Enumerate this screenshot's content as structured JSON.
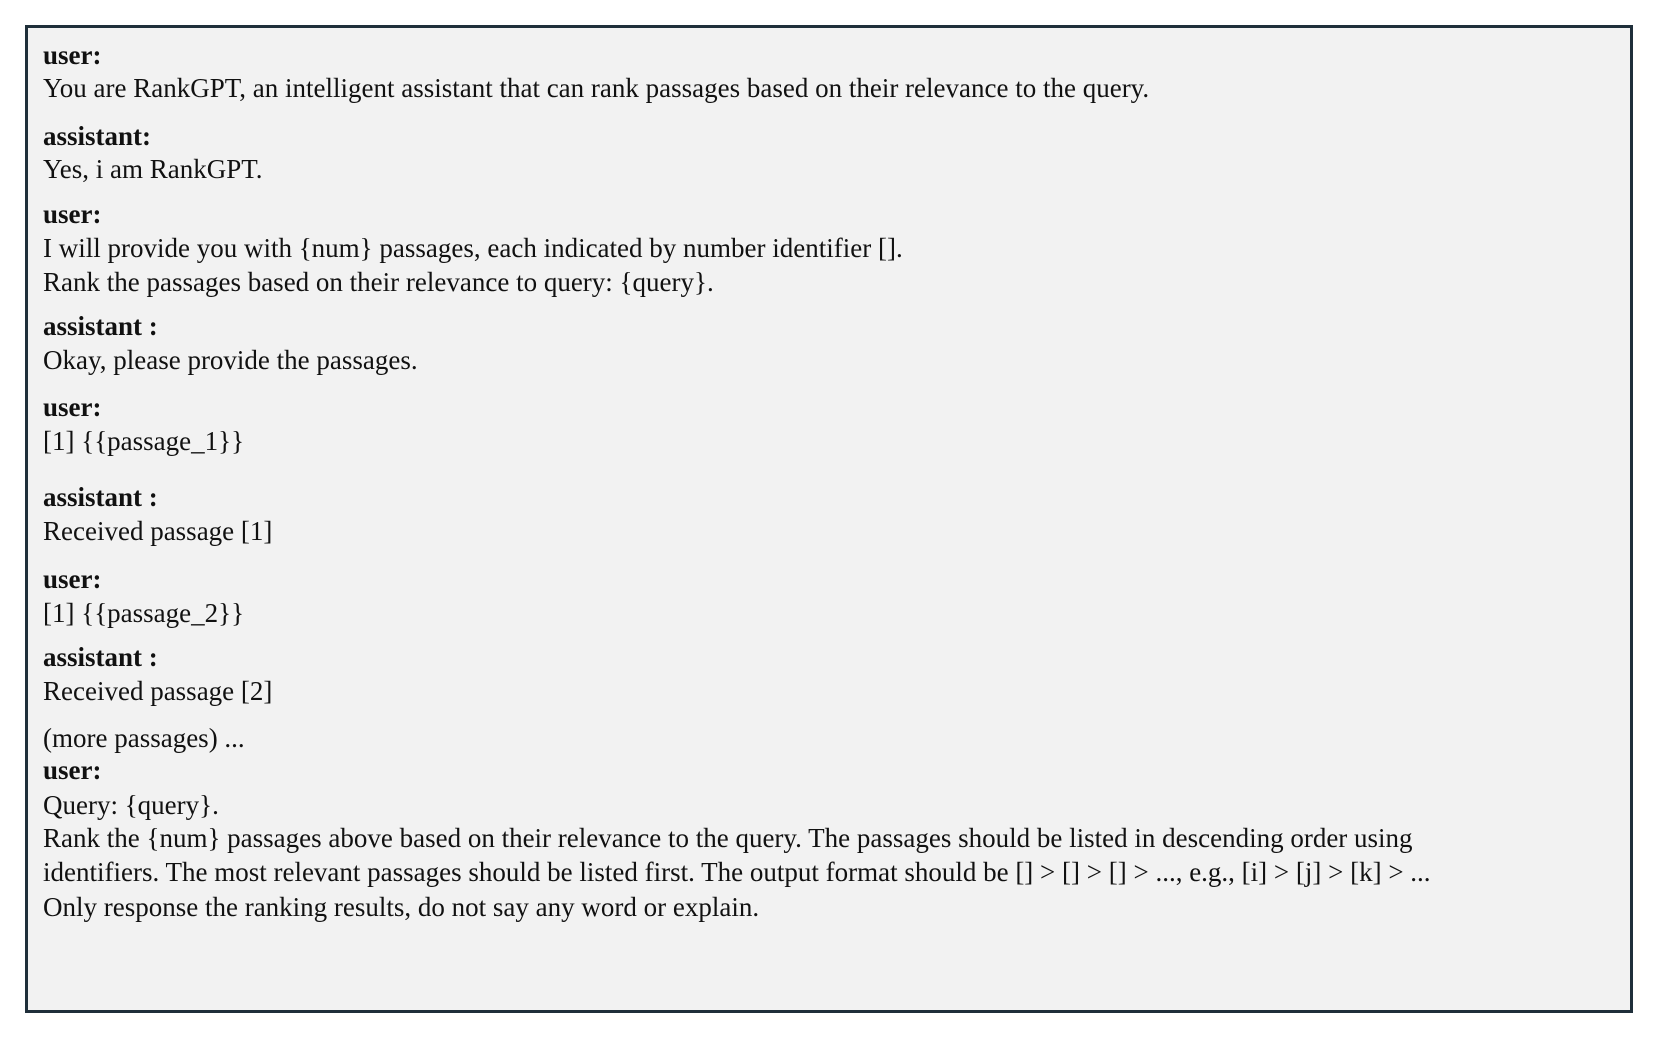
{
  "document": {
    "lines": [
      {
        "role": true,
        "text": "user:"
      },
      {
        "role": false,
        "text": "You are RankGPT, an intelligent assistant that can rank passages based on their relevance to the query."
      },
      {
        "role": true,
        "text": "assistant:"
      },
      {
        "role": false,
        "text": "Yes, i am RankGPT."
      },
      {
        "role": true,
        "text": "user:"
      },
      {
        "role": false,
        "text": "I will provide you with {num} passages, each indicated by number identifier []."
      },
      {
        "role": false,
        "text": "Rank the passages based on their relevance to query: {query}."
      },
      {
        "role": true,
        "text": "assistant :"
      },
      {
        "role": false,
        "text": "Okay, please provide the passages."
      },
      {
        "role": true,
        "text": "user:"
      },
      {
        "role": false,
        "text": "[1] {{passage_1}}"
      },
      {
        "role": true,
        "text": "assistant :"
      },
      {
        "role": false,
        "text": "Received passage [1]"
      },
      {
        "role": true,
        "text": "user:"
      },
      {
        "role": false,
        "text": "[1] {{passage_2}}"
      },
      {
        "role": true,
        "text": "assistant :"
      },
      {
        "role": false,
        "text": "Received passage [2]"
      },
      {
        "role": false,
        "text": "(more passages) ..."
      },
      {
        "role": true,
        "text": "user:"
      },
      {
        "role": false,
        "text": "Query: {query}."
      },
      {
        "role": false,
        "text": "Rank the {num} passages above based on their relevance to the query. The passages should be listed in descending order using"
      },
      {
        "role": false,
        "text": "identifiers. The most relevant passages should be listed first. The output format should be [] > [] > [] > ..., e.g., [i] > [j] > [k] > ..."
      },
      {
        "role": false,
        "text": "Only response the ranking results, do not say any word or explain."
      }
    ]
  }
}
